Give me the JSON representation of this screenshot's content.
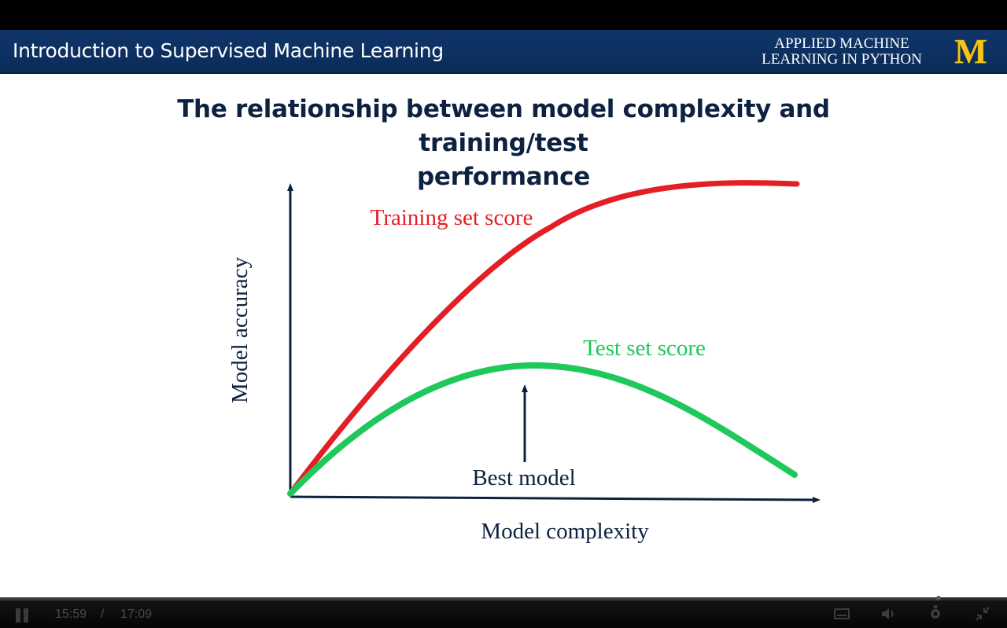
{
  "header": {
    "course_title": "Introduction to Supervised Machine Learning",
    "brand_line1": "APPLIED MACHINE",
    "brand_line2": "LEARNING IN PYTHON",
    "logo_letter": "M"
  },
  "slide": {
    "title_line1": "The relationship between model complexity and training/test",
    "title_line2": "performance"
  },
  "diagram": {
    "y_axis_label": "Model accuracy",
    "x_axis_label": "Model complexity",
    "training_label": "Training set score",
    "test_label": "Test set score",
    "best_label": "Best model",
    "colors": {
      "training": "#e31e24",
      "test": "#1ec85a",
      "axis": "#0d2240"
    }
  },
  "player": {
    "current_time": "15:59",
    "separator": "/",
    "duration": "17:09",
    "progress": 0.932,
    "icons": [
      "pause-icon",
      "captions-icon",
      "volume-icon",
      "settings-icon",
      "exit-fullscreen-icon"
    ]
  }
}
